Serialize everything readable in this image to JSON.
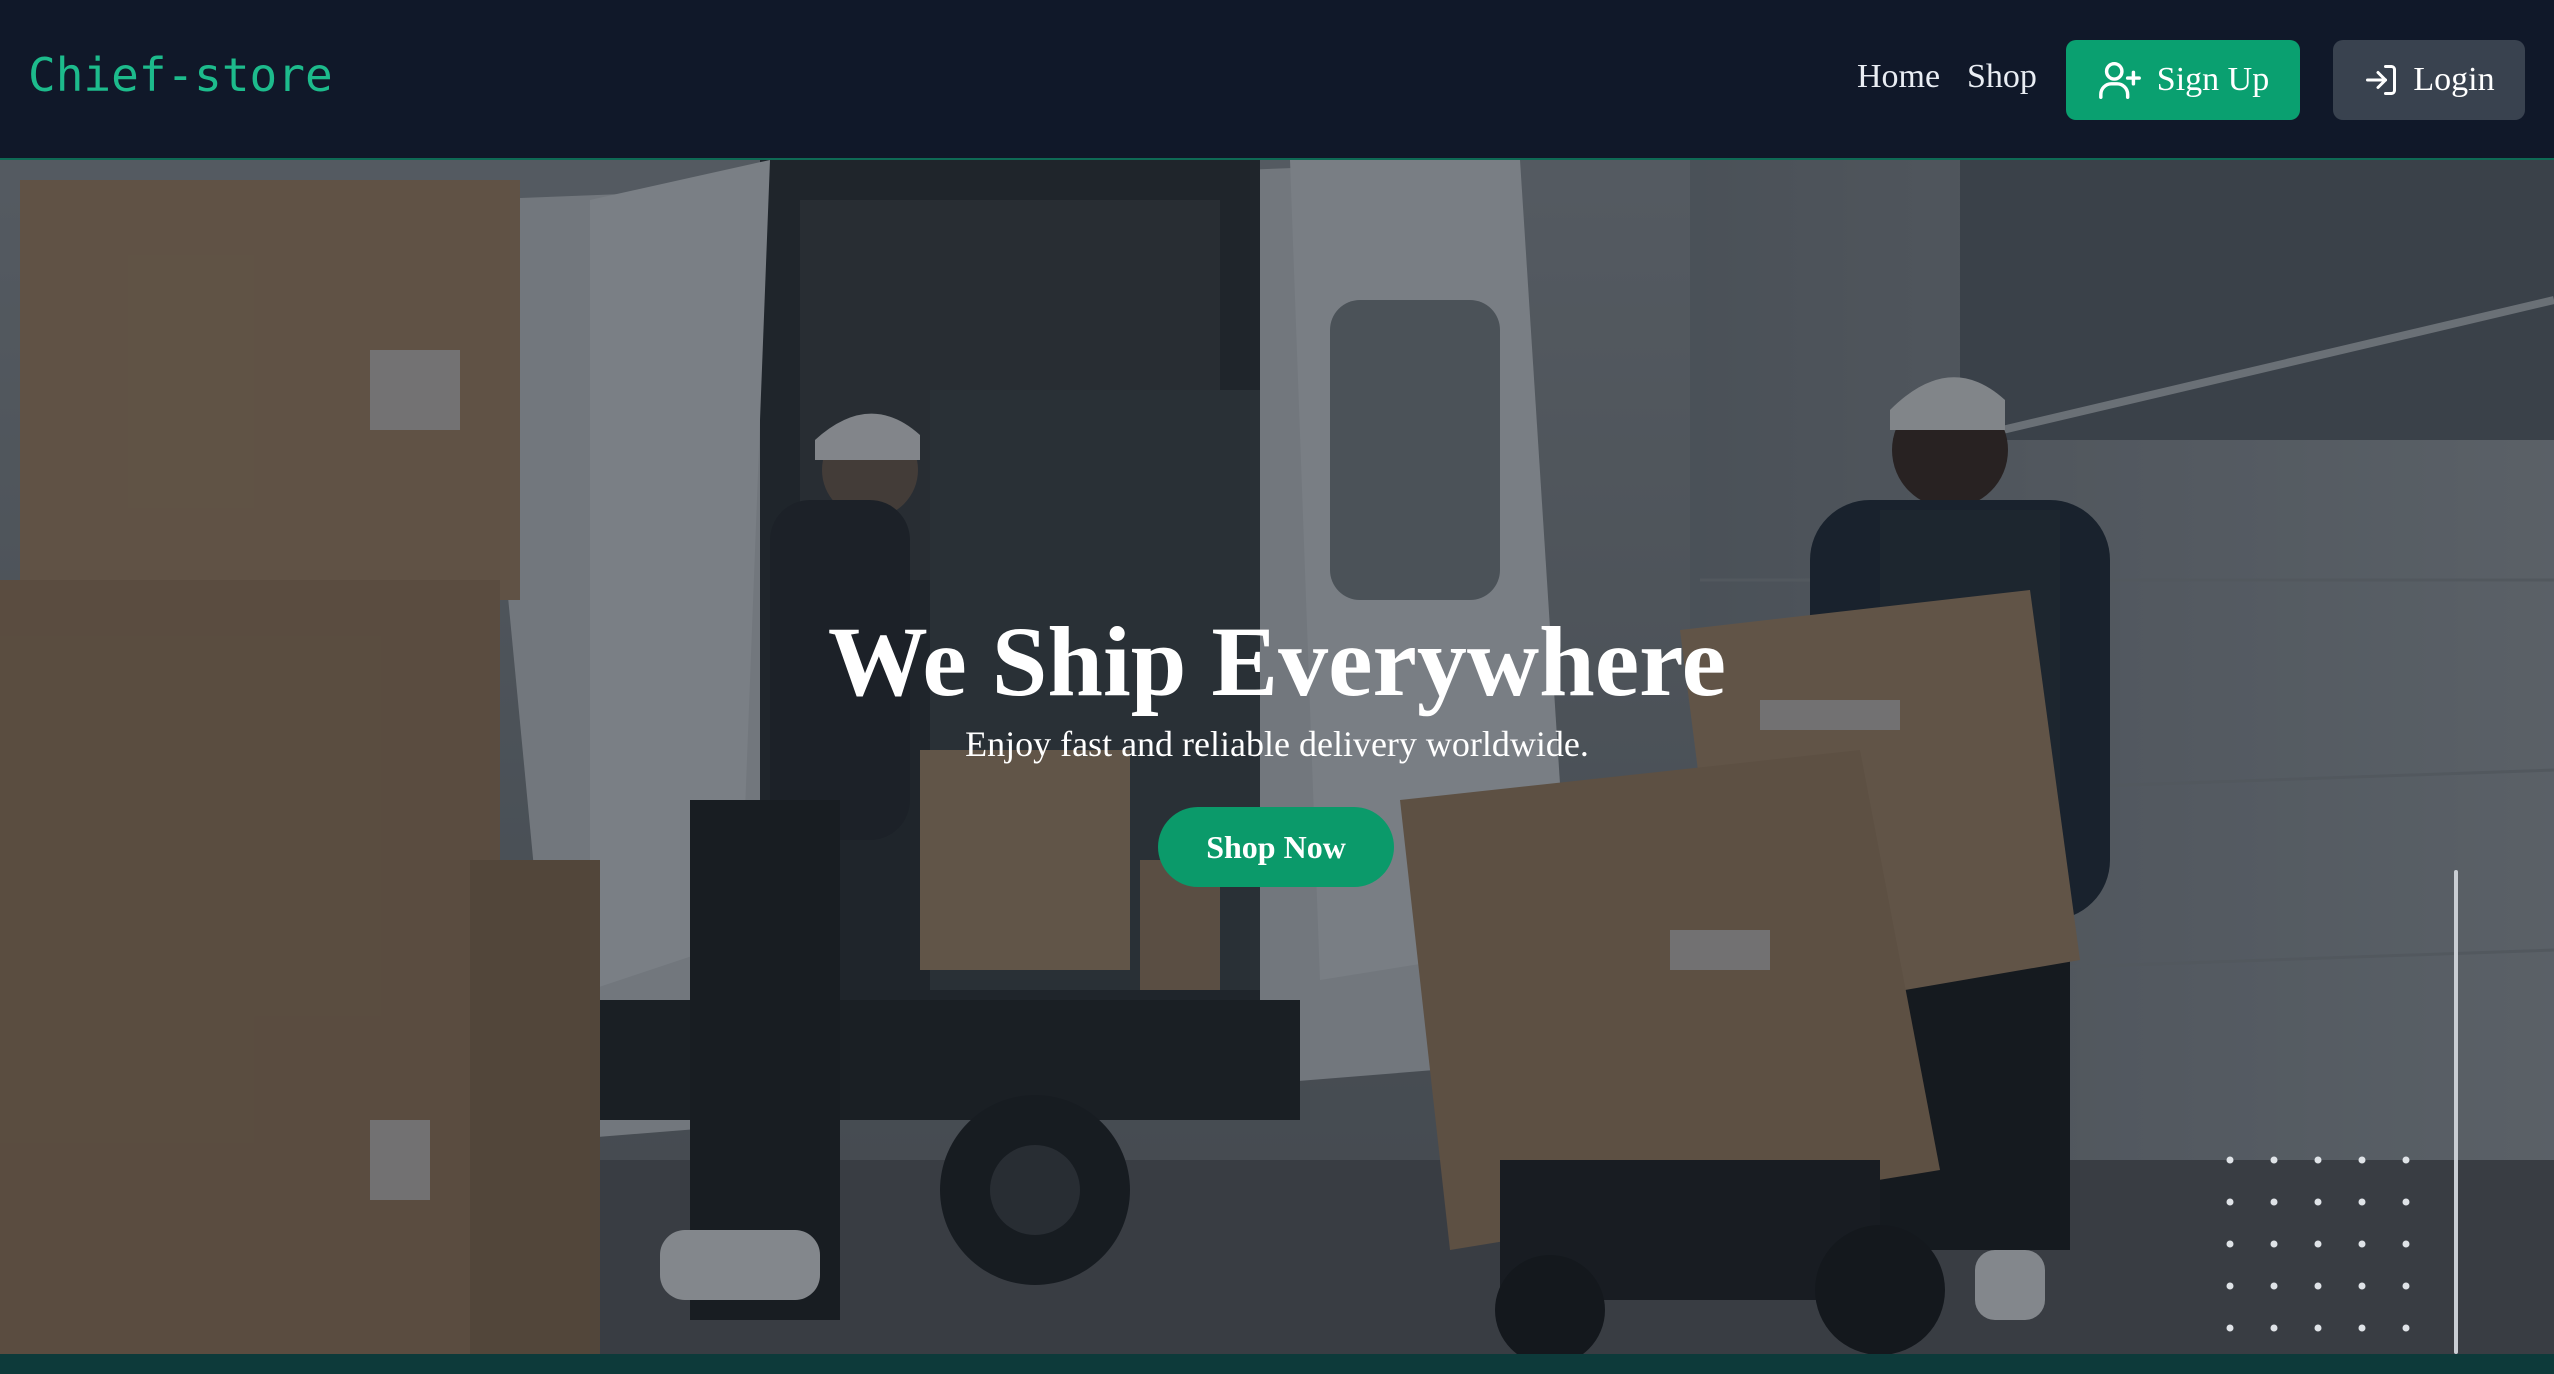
{
  "nav": {
    "brand": "Chief-store",
    "home_label": "Home",
    "shop_label": "Shop",
    "signup_label": "Sign Up",
    "signup_icon": "user-plus-icon",
    "login_label": "Login",
    "login_icon": "log-in-icon"
  },
  "hero": {
    "title": "We Ship Everywhere",
    "subtitle": "Enjoy fast and reliable delivery worldwide.",
    "cta_label": "Shop Now",
    "background": "delivery-van-photo"
  },
  "colors": {
    "accent": "#0aa070",
    "brand": "#1dbb8c",
    "nav_bg": "#101829",
    "login_bg": "#39424f"
  }
}
